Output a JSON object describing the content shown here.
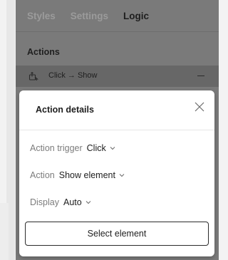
{
  "tabs": {
    "styles": "Styles",
    "settings": "Settings",
    "logic": "Logic",
    "active": "logic"
  },
  "actions": {
    "section_title": "Actions",
    "items": [
      {
        "label": "Click → Show",
        "icon": "interaction-icon",
        "remove_icon": "minus-icon"
      }
    ]
  },
  "action_details": {
    "title": "Action details",
    "close_icon": "close-icon",
    "trigger": {
      "label": "Action trigger",
      "value": "Click"
    },
    "action": {
      "label": "Action",
      "value": "Show element"
    },
    "display": {
      "label": "Display",
      "value": "Auto"
    },
    "select_button": "Select element"
  }
}
